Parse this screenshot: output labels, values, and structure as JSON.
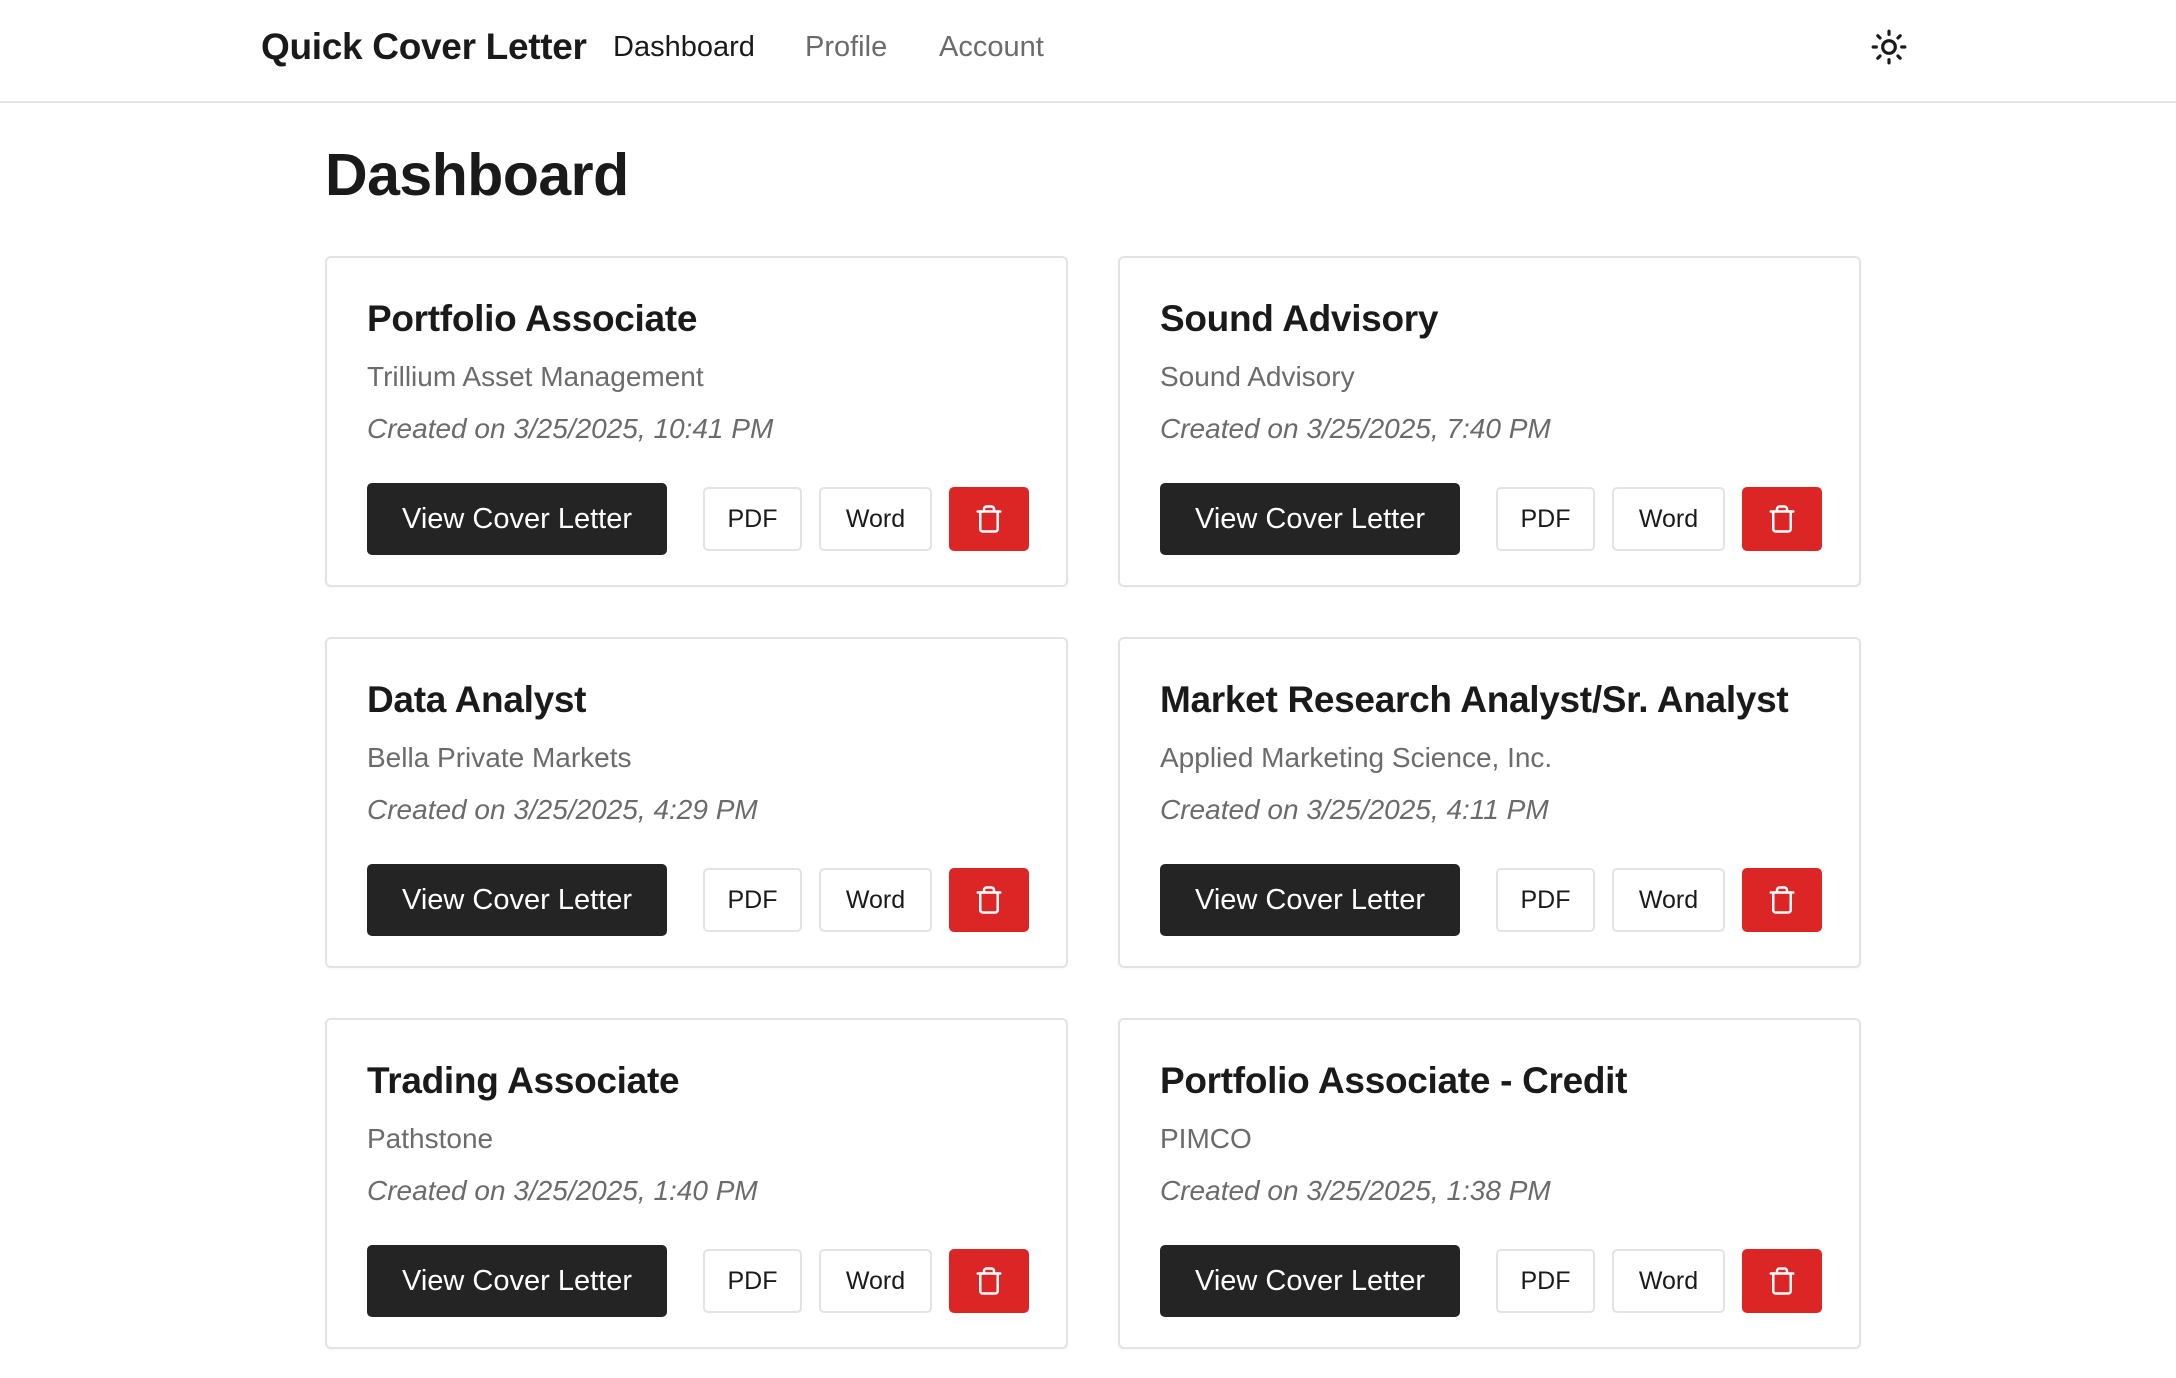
{
  "nav": {
    "brand": "Quick Cover Letter",
    "links": [
      {
        "label": "Dashboard",
        "active": true
      },
      {
        "label": "Profile",
        "active": false
      },
      {
        "label": "Account",
        "active": false
      }
    ],
    "theme_icon": "sun-icon"
  },
  "page": {
    "title": "Dashboard"
  },
  "buttons": {
    "view": "View Cover Letter",
    "pdf": "PDF",
    "word": "Word",
    "delete_icon": "trash-icon"
  },
  "colors": {
    "primary_button": "#242424",
    "delete_button": "#dc2626",
    "muted_text": "#6b6b6b"
  },
  "cards": [
    {
      "title": "Portfolio Associate",
      "company": "Trillium Asset Management",
      "created": "Created on 3/25/2025, 10:41 PM"
    },
    {
      "title": "Sound Advisory",
      "company": "Sound Advisory",
      "created": "Created on 3/25/2025, 7:40 PM"
    },
    {
      "title": "Data Analyst",
      "company": "Bella Private Markets",
      "created": "Created on 3/25/2025, 4:29 PM"
    },
    {
      "title": "Market Research Analyst/Sr. Analyst",
      "company": "Applied Marketing Science, Inc.",
      "created": "Created on 3/25/2025, 4:11 PM"
    },
    {
      "title": "Trading Associate",
      "company": "Pathstone",
      "created": "Created on 3/25/2025, 1:40 PM"
    },
    {
      "title": "Portfolio Associate - Credit",
      "company": "PIMCO",
      "created": "Created on 3/25/2025, 1:38 PM"
    }
  ]
}
